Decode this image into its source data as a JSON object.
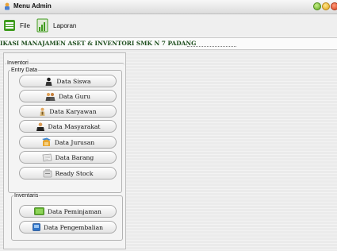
{
  "window": {
    "title": "Menu Admin"
  },
  "menu": {
    "file_label": "File",
    "laporan_label": "Laporan"
  },
  "banner": {
    "text": "IKASI MANAJAMEN ASET & INVENTORI SMK N 7 PADANG"
  },
  "panel": {
    "outer_legend": "Inventori",
    "entry_legend": "Entry Data",
    "inventaris_legend": "Inventaris",
    "entry_buttons": [
      {
        "label": "Data Siswa",
        "icon": "student-icon"
      },
      {
        "label": "Data Guru",
        "icon": "teachers-icon"
      },
      {
        "label": "Data Karyawan",
        "icon": "employee-icon"
      },
      {
        "label": "Data Masyarakat",
        "icon": "community-icon"
      },
      {
        "label": "Data Jurusan",
        "icon": "major-icon"
      },
      {
        "label": "Data Barang",
        "icon": "document-icon"
      },
      {
        "label": "Ready Stock",
        "icon": "stock-icon"
      }
    ],
    "inventaris_buttons": [
      {
        "label": "Data Peminjaman",
        "icon": "loan-icon"
      },
      {
        "label": "Data Pengembalian",
        "icon": "return-icon"
      }
    ]
  },
  "colors": {
    "banner_text": "#1f4f1f",
    "menu_icon_green": "#3f9b1e"
  }
}
